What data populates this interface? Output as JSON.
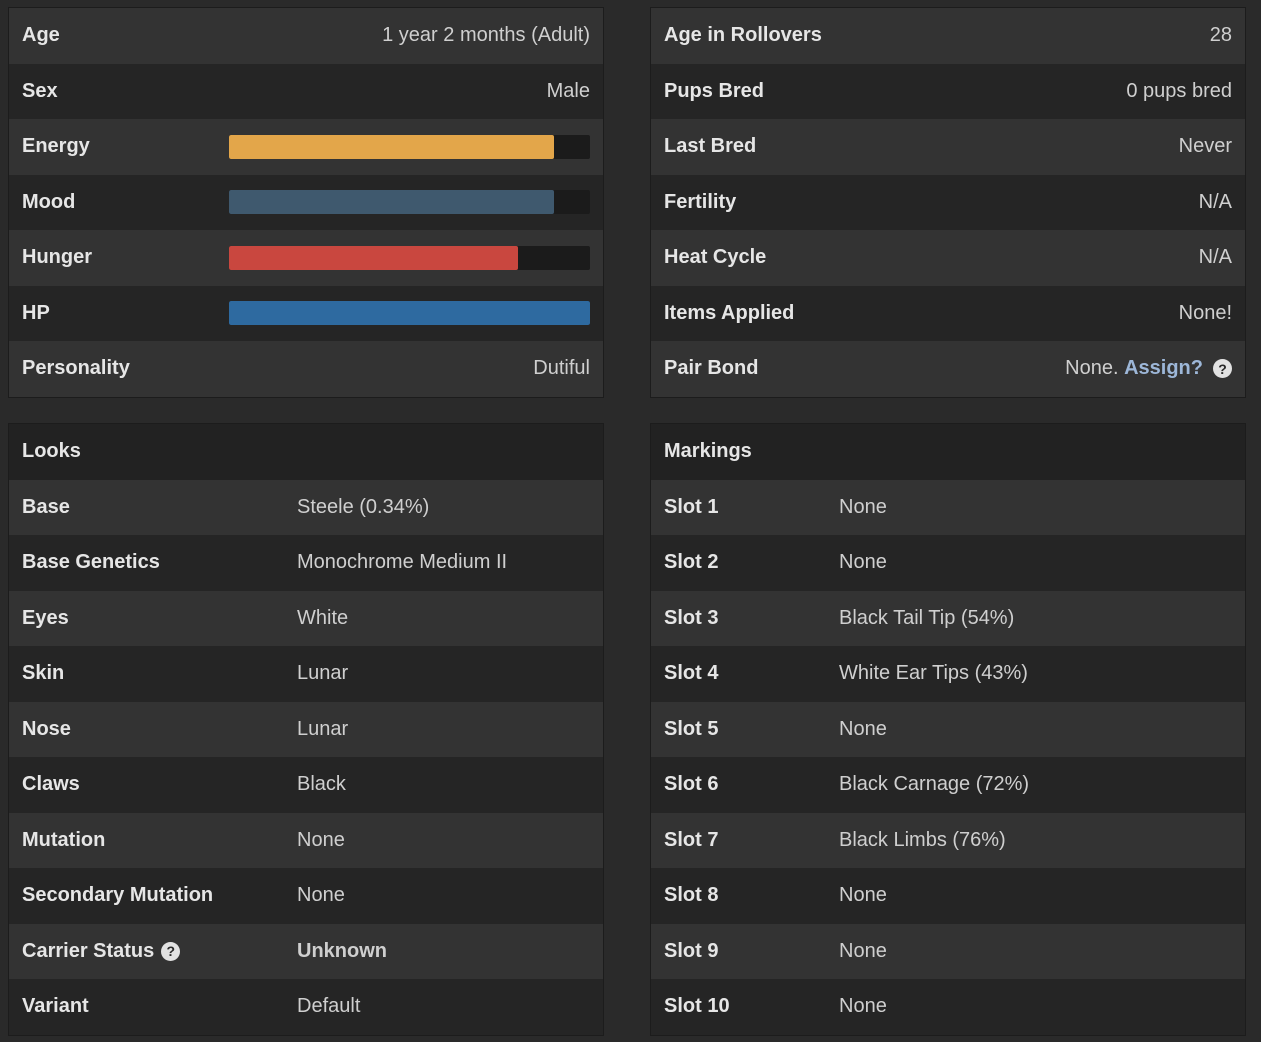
{
  "stats": {
    "age": {
      "label": "Age",
      "value": "1 year 2 months (Adult)"
    },
    "sex": {
      "label": "Sex",
      "value": "Male"
    },
    "energy": {
      "label": "Energy",
      "percent": 90,
      "color": "#e3a64a"
    },
    "mood": {
      "label": "Mood",
      "percent": 90,
      "color": "#3f596e"
    },
    "hunger": {
      "label": "Hunger",
      "percent": 80,
      "color": "#c9473f"
    },
    "hp": {
      "label": "HP",
      "percent": 100,
      "color": "#2e6aa0"
    },
    "personality": {
      "label": "Personality",
      "value": "Dutiful"
    }
  },
  "breeding": {
    "rollovers": {
      "label": "Age in Rollovers",
      "value": "28"
    },
    "pups": {
      "label": "Pups Bred",
      "value": "0 pups bred"
    },
    "last_bred": {
      "label": "Last Bred",
      "value": "Never"
    },
    "fertility": {
      "label": "Fertility",
      "value": "N/A"
    },
    "heat": {
      "label": "Heat Cycle",
      "value": "N/A"
    },
    "items": {
      "label": "Items Applied",
      "value": "None!"
    },
    "pair_bond": {
      "label": "Pair Bond",
      "value": "None.",
      "link": "Assign?",
      "help_icon": "question-circle-icon"
    }
  },
  "looks": {
    "title": "Looks",
    "rows": [
      {
        "label": "Base",
        "value": "Steele (0.34%)"
      },
      {
        "label": "Base Genetics",
        "value": "Monochrome Medium II"
      },
      {
        "label": "Eyes",
        "value": "White"
      },
      {
        "label": "Skin",
        "value": "Lunar"
      },
      {
        "label": "Nose",
        "value": "Lunar"
      },
      {
        "label": "Claws",
        "value": "Black"
      },
      {
        "label": "Mutation",
        "value": "None"
      },
      {
        "label": "Secondary Mutation",
        "value": "None"
      },
      {
        "label": "Carrier Status",
        "value": "Unknown",
        "help_icon": "question-circle-icon"
      },
      {
        "label": "Variant",
        "value": "Default"
      }
    ]
  },
  "markings": {
    "title": "Markings",
    "rows": [
      {
        "label": "Slot 1",
        "value": "None"
      },
      {
        "label": "Slot 2",
        "value": "None"
      },
      {
        "label": "Slot 3",
        "value": "Black Tail Tip (54%)"
      },
      {
        "label": "Slot 4",
        "value": "White Ear Tips (43%)"
      },
      {
        "label": "Slot 5",
        "value": "None"
      },
      {
        "label": "Slot 6",
        "value": "Black Carnage (72%)"
      },
      {
        "label": "Slot 7",
        "value": "Black Limbs (76%)"
      },
      {
        "label": "Slot 8",
        "value": "None"
      },
      {
        "label": "Slot 9",
        "value": "None"
      },
      {
        "label": "Slot 10",
        "value": "None"
      }
    ]
  }
}
